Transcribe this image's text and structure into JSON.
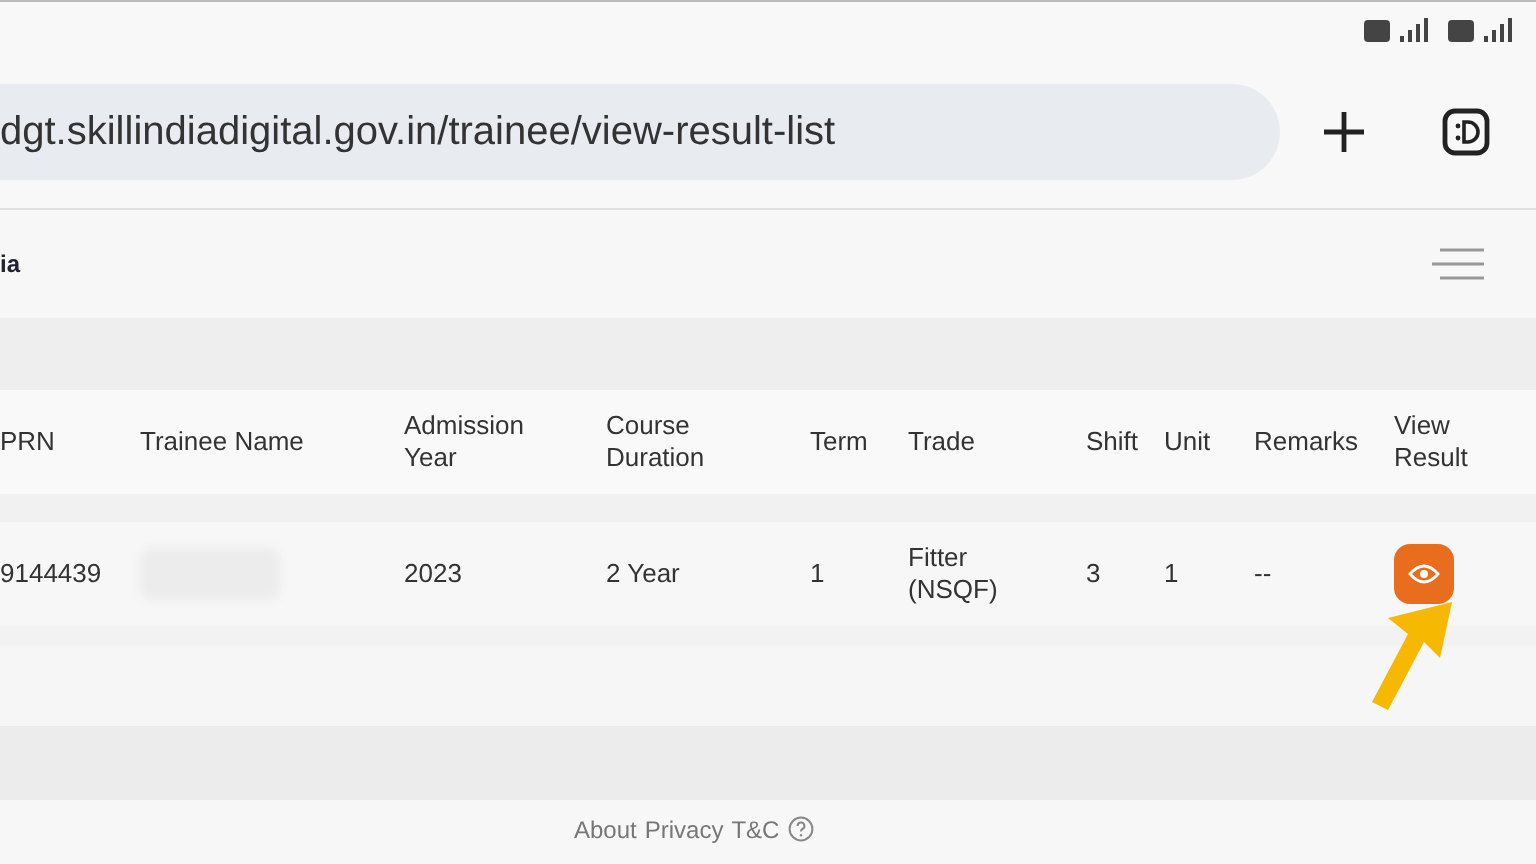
{
  "browser": {
    "url": "dgt.skillindiadigital.gov.in/trainee/view-result-list"
  },
  "header": {
    "logo_text": "ia"
  },
  "table": {
    "columns": [
      "PRN",
      "Trainee Name",
      "Admission Year",
      "Course Duration",
      "Term",
      "Trade",
      "Shift",
      "Unit",
      "Remarks",
      "View Result"
    ],
    "rows": [
      {
        "prn": "9144439",
        "admission_year": "2023",
        "course_duration": "2 Year",
        "term": "1",
        "trade": "Fitter (NSQF)",
        "shift": "3",
        "unit": "1",
        "remarks": "--"
      }
    ]
  },
  "footer": {
    "links": [
      "About",
      "Privacy",
      "T&C"
    ]
  }
}
